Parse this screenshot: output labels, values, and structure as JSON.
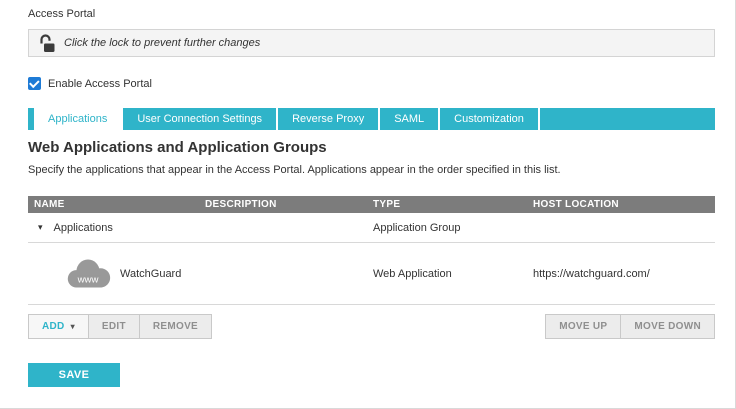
{
  "page": {
    "title": "Access Portal"
  },
  "lock_banner": {
    "text": "Click the lock to prevent further changes"
  },
  "enable": {
    "label": "Enable Access Portal",
    "checked": true
  },
  "tabs": {
    "active": "Applications",
    "items": [
      {
        "label": "Applications"
      },
      {
        "label": "User Connection Settings"
      },
      {
        "label": "Reverse Proxy"
      },
      {
        "label": "SAML"
      },
      {
        "label": "Customization"
      }
    ]
  },
  "section": {
    "heading": "Web Applications and Application Groups",
    "description": "Specify the applications that appear in the Access Portal. Applications appear in the order specified in this list."
  },
  "table": {
    "headers": [
      "NAME",
      "DESCRIPTION",
      "TYPE",
      "HOST LOCATION"
    ],
    "rows": [
      {
        "name": "Applications",
        "description": "",
        "type": "Application Group",
        "host": ""
      },
      {
        "name": "WatchGuard",
        "description": "",
        "type": "Web Application",
        "host": "https://watchguard.com/",
        "icon_text": "www"
      }
    ]
  },
  "icons": {
    "collapse_caret": "▾",
    "add_dropdown_caret": "▾"
  },
  "toolbar": {
    "add_label": "ADD",
    "edit_label": "EDIT",
    "remove_label": "REMOVE",
    "move_up_label": "MOVE UP",
    "move_down_label": "MOVE DOWN"
  },
  "actions": {
    "save_label": "SAVE"
  },
  "colors": {
    "accent_cyan": "#2fb4c9",
    "table_header_gray": "#7c7c7c",
    "checkbox_blue": "#1e7bd6",
    "banner_gray": "#f4f4f4"
  }
}
